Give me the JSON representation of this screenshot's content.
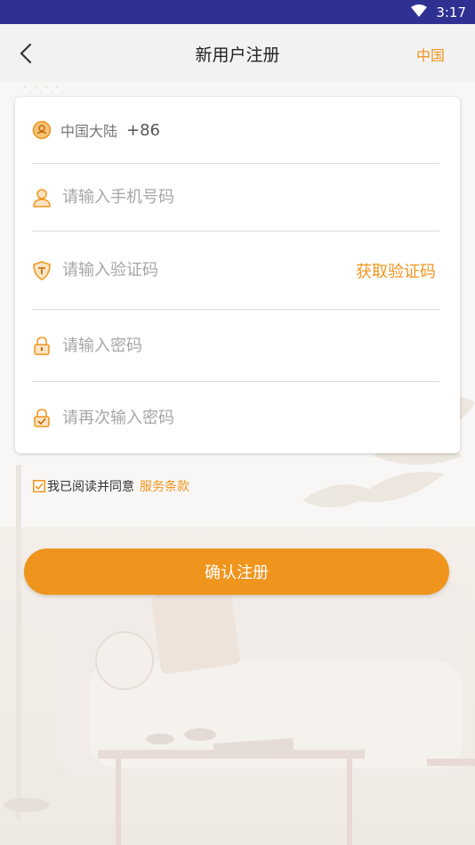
{
  "status_bar": {
    "time": "3:17"
  },
  "header": {
    "title": "新用户注册",
    "region": "中国"
  },
  "form": {
    "country": {
      "label": "中国大陆",
      "code": "+86"
    },
    "phone": {
      "placeholder": "请输入手机号码"
    },
    "code": {
      "placeholder": "请输入验证码",
      "get_code_label": "获取验证码"
    },
    "password": {
      "placeholder": "请输入密码"
    },
    "confirm": {
      "placeholder": "请再次输入密码"
    }
  },
  "agreement": {
    "text": "我已阅读并同意",
    "link": "服务条款",
    "checked": true
  },
  "submit_label": "确认注册",
  "colors": {
    "accent": "#ef951d",
    "status_bar": "#2e3192"
  },
  "icons": [
    "wifi-icon",
    "back-icon",
    "location-icon",
    "user-icon",
    "shield-icon",
    "lock-icon",
    "lock-check-icon",
    "checkbox-icon"
  ]
}
